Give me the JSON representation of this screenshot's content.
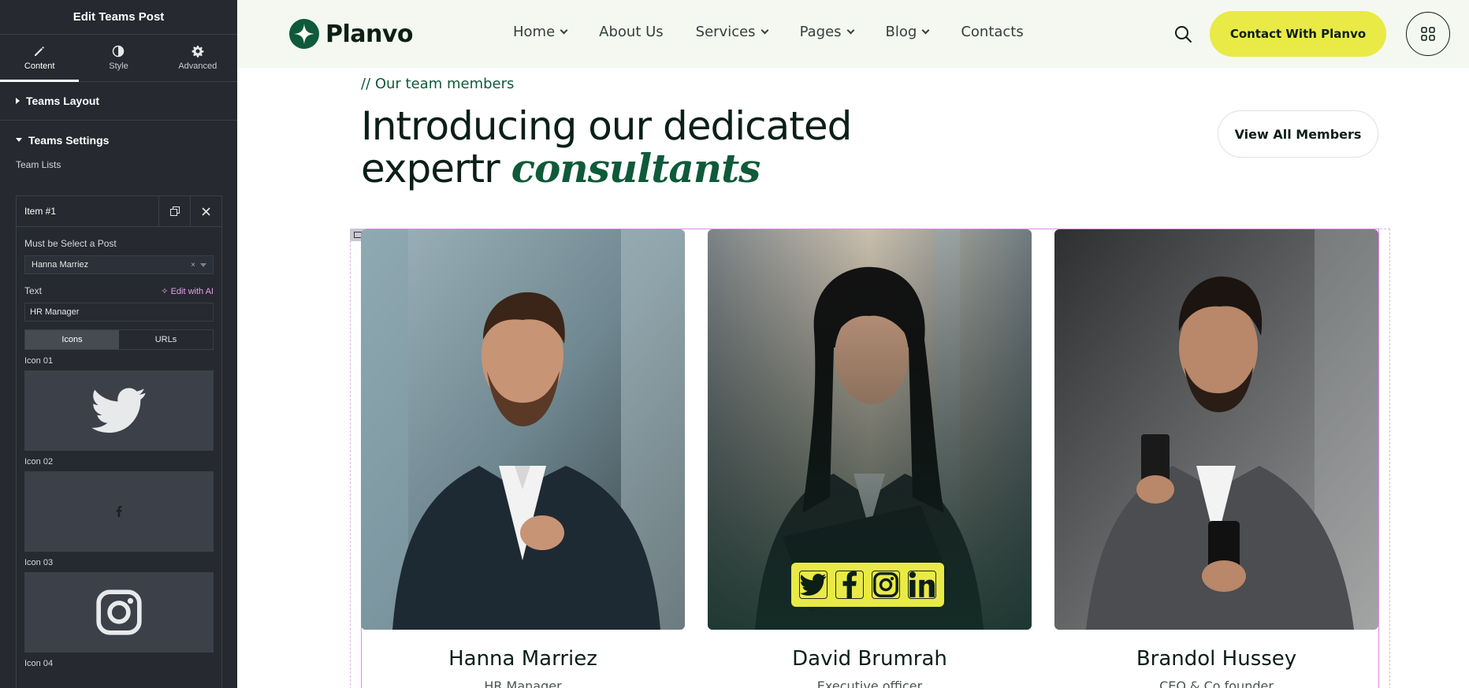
{
  "editor": {
    "title": "Edit Teams Post",
    "tabs": [
      {
        "label": "Content",
        "icon": "pencil-icon"
      },
      {
        "label": "Style",
        "icon": "contrast-icon"
      },
      {
        "label": "Advanced",
        "icon": "gear-icon"
      }
    ],
    "sections": {
      "layout": "Teams Layout",
      "settings": "Teams Settings"
    },
    "team_lists_label": "Team Lists",
    "item": {
      "title": "Item #1",
      "post_label": "Must be Select a Post",
      "post_value": "Hanna Marriez",
      "clear_glyph": "×",
      "text_label": "Text",
      "edit_ai": "Edit with AI",
      "text_value": "HR Manager",
      "segments": [
        "Icons",
        "URLs"
      ],
      "icons": [
        {
          "label": "Icon 01",
          "icon": "twitter-icon"
        },
        {
          "label": "Icon 02",
          "icon": "facebook-icon"
        },
        {
          "label": "Icon 03",
          "icon": "instagram-icon"
        },
        {
          "label": "Icon 04"
        }
      ]
    }
  },
  "site": {
    "brand": "Planvo",
    "nav": [
      {
        "label": "Home",
        "dropdown": true
      },
      {
        "label": "About Us",
        "dropdown": false
      },
      {
        "label": "Services",
        "dropdown": true
      },
      {
        "label": "Pages",
        "dropdown": true
      },
      {
        "label": "Blog",
        "dropdown": true
      },
      {
        "label": "Contacts",
        "dropdown": false
      }
    ],
    "cta": "Contact With Planvo",
    "eyebrow": "// Our team members",
    "headline_line1": "Introducing our dedicated",
    "headline_line2_plain": "expertr ",
    "headline_line2_accent": "consultants",
    "view_all": "View All Members",
    "members": [
      {
        "name": "Hanna Marriez",
        "role": "HR Manager"
      },
      {
        "name": "David Brumrah",
        "role": "Executive officer"
      },
      {
        "name": "Brandol Hussey",
        "role": "CEO & Co founder"
      }
    ],
    "colors": {
      "accent_yellow": "#e9ea45",
      "brand_green": "#0f5a3a",
      "dark": "#0b1f17",
      "editor_bg": "#26292f"
    }
  }
}
